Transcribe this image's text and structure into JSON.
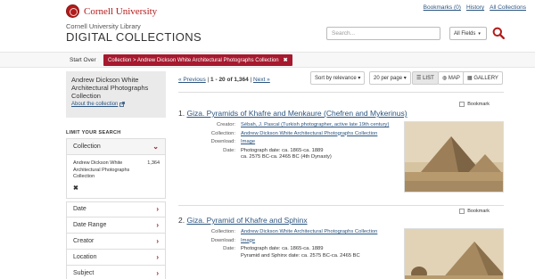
{
  "header": {
    "logo_text": "Cornell University",
    "library_name": "Cornell University Library",
    "site_title": "DIGITAL COLLECTIONS",
    "links": [
      "Bookmarks (0)",
      "History",
      "All Collections"
    ],
    "search_placeholder": "Search...",
    "search_field": "All Fields",
    "icons": {
      "logo": "cornell-seal-icon",
      "search": "search-icon",
      "dropdown": "caret-down-icon"
    }
  },
  "crumbs": {
    "start_over": "Start Over",
    "constraint": "Collection > Andrew Dickson White Architectural Photographs Collection",
    "remove_symbol": "✖"
  },
  "sidebar": {
    "collection_name": "Andrew Dickson White Architectural Photographs Collection",
    "about_link": "About the collection",
    "limit_title": "LIMIT YOUR SEARCH",
    "open_facet": {
      "label": "Collection",
      "value": "Andrew Dickson White Architectural Photographs Collection",
      "count": "1,364",
      "remove_symbol": "✖"
    },
    "facets": [
      "Date",
      "Date Range",
      "Creator",
      "Location",
      "Subject"
    ]
  },
  "results": {
    "pager_prev": "« Previous",
    "pager_sep": "|",
    "pager_range": "1 - 20 of 1,364",
    "pager_next": "Next »",
    "sort_label": "Sort by relevance",
    "per_page_label": "20 per page",
    "view_list": "LIST",
    "view_map": "MAP",
    "view_gallery": "GALLERY",
    "bookmark_label": "Bookmark",
    "items": [
      {
        "number": "1.",
        "title": "Giza. Pyramids of Khafre and Menkaure (Chefren and Mykerinus)",
        "fields": [
          {
            "label": "Creator:",
            "value": "Sébah, J. Pascal (Turkish photographer, active late 19th century)",
            "link": true
          },
          {
            "label": "Collection:",
            "value": "Andrew Dickson White Architectural Photographs Collection",
            "link": true
          },
          {
            "label": "Download:",
            "value": "Image",
            "link": true
          },
          {
            "label": "Date:",
            "value": "Photograph date: ca. 1865-ca. 1889",
            "link": false
          },
          {
            "label": "",
            "value": "ca. 2575 BC-ca. 2465 BC (4th Dynasty)",
            "link": false
          }
        ]
      },
      {
        "number": "2.",
        "title": "Giza. Pyramid of Khafre and Sphinx",
        "fields": [
          {
            "label": "Collection:",
            "value": "Andrew Dickson White Architectural Photographs Collection",
            "link": true
          },
          {
            "label": "Download:",
            "value": "Image",
            "link": true
          },
          {
            "label": "Date:",
            "value": "Photograph date: ca. 1865-ca. 1889",
            "link": false
          },
          {
            "label": "",
            "value": "Pyramid and Sphinx date: ca. 2575 BC-ca. 2465 BC",
            "link": false
          }
        ]
      }
    ]
  },
  "colors": {
    "accent": "#a6192e",
    "link": "#2c5580",
    "photo": "#b89a6f"
  }
}
